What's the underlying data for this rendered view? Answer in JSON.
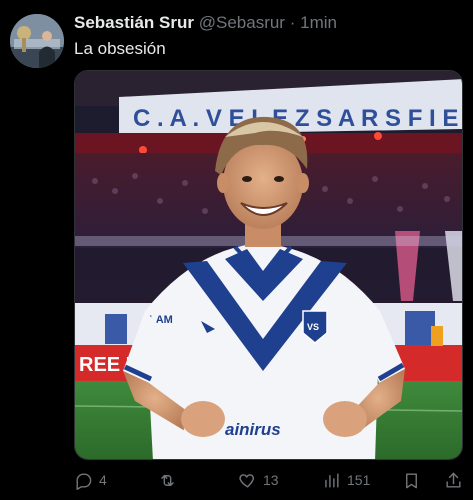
{
  "post": {
    "author_name": "Sebastián Srur",
    "handle": "@Sebasrur",
    "separator": "·",
    "time": "1min",
    "text": "La obsesión"
  },
  "media": {
    "banner_text": "C . A . V E L E Z   S A R S F I E",
    "shirt_word": "LAM",
    "sponsor_text": "ainirus",
    "ad_board_text": "REE DE"
  },
  "actions": {
    "replies": "4",
    "retweets": "",
    "likes": "13",
    "views": "151"
  },
  "colors": {
    "background": "#000000",
    "text_primary": "#e7e9ea",
    "text_secondary": "#71767b",
    "kit_blue": "#1f3f8f"
  }
}
